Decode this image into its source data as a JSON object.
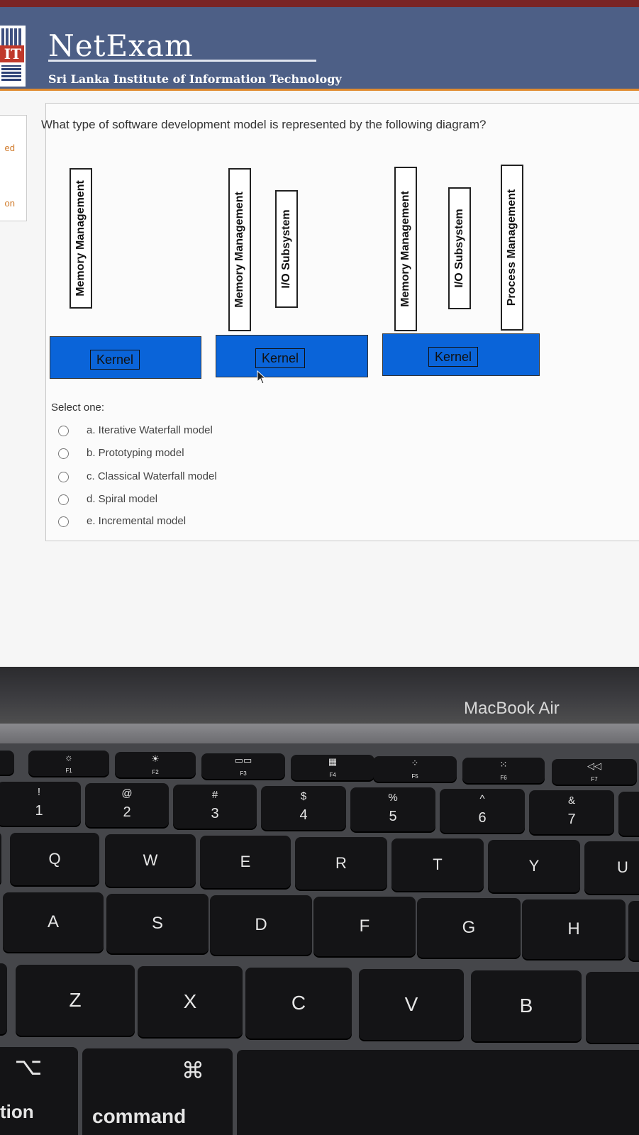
{
  "app": {
    "name": "NetExam",
    "institute": "Sri Lanka Institute of Information Technology",
    "logo_text": "IT"
  },
  "left_nav": {
    "item1": "ed",
    "item2": "on"
  },
  "question": {
    "text": "What type of software development model is represented by the following diagram?",
    "diagram": {
      "groups": [
        {
          "boxes": [
            "Memory Management"
          ],
          "base": "Kernel"
        },
        {
          "boxes": [
            "Memory Management",
            "I/O Subsystem"
          ],
          "base": "Kernel"
        },
        {
          "boxes": [
            "Memory Management",
            "I/O Subsystem",
            "Process Management"
          ],
          "base": "Kernel"
        }
      ]
    },
    "select_label": "Select one:",
    "options": [
      "a. Iterative Waterfall model",
      "b. Prototyping model",
      "c. Classical Waterfall model",
      "d. Spiral model",
      "e. Incremental model"
    ]
  },
  "laptop": {
    "model": "MacBook Air",
    "function_row": [
      {
        "icon": "sun-small",
        "glyph": "☼",
        "label": "F1"
      },
      {
        "icon": "sun-large",
        "glyph": "☀",
        "label": "F2"
      },
      {
        "icon": "mission-control",
        "glyph": "▭▭",
        "label": "F3"
      },
      {
        "icon": "launchpad",
        "glyph": "▦",
        "label": "F4"
      },
      {
        "icon": "keyboard-dim",
        "glyph": "⁘",
        "label": "F5"
      },
      {
        "icon": "keyboard-bright",
        "glyph": "⁙",
        "label": "F6"
      },
      {
        "icon": "rewind",
        "glyph": "◁◁",
        "label": "F7"
      }
    ],
    "number_row": [
      {
        "top": "!",
        "main": "1"
      },
      {
        "top": "@",
        "main": "2"
      },
      {
        "top": "#",
        "main": "3"
      },
      {
        "top": "$",
        "main": "4"
      },
      {
        "top": "%",
        "main": "5"
      },
      {
        "top": "^",
        "main": "6"
      },
      {
        "top": "&",
        "main": "7"
      }
    ],
    "qwerty_row": [
      "Q",
      "W",
      "E",
      "R",
      "T",
      "Y",
      "U"
    ],
    "home_row": [
      "A",
      "S",
      "D",
      "F",
      "G",
      "H"
    ],
    "bottom_row": [
      "Z",
      "X",
      "C",
      "V",
      "B"
    ],
    "modifiers": {
      "option_symbol": "⌥",
      "option_label": "tion",
      "command_symbol": "⌘",
      "command_label": "command"
    }
  }
}
